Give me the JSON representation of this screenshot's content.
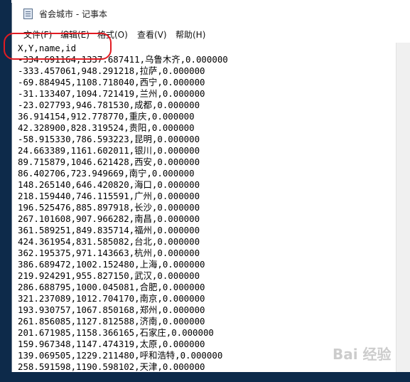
{
  "window": {
    "title": "省会城市 - 记事本"
  },
  "menu": [
    "文件(F)",
    "编辑(E)",
    "格式(O)",
    "查看(V)",
    "帮助(H)"
  ],
  "lines": [
    "X,Y,name,id",
    "-334.691164,1337.687411,乌鲁木齐,0.000000",
    "-333.457061,948.291218,拉萨,0.000000",
    "-69.884945,1108.718040,西宁,0.000000",
    "-31.133407,1094.721419,兰州,0.000000",
    "-23.027793,946.781530,成都,0.000000",
    "36.914154,912.778770,重庆,0.000000",
    "42.328900,828.319524,贵阳,0.000000",
    "-58.915330,786.593223,昆明,0.000000",
    "24.663389,1161.602011,银川,0.000000",
    "89.715879,1046.621428,西安,0.000000",
    "86.402706,723.949669,南宁,0.000000",
    "148.265140,646.420820,海口,0.000000",
    "218.159440,746.115591,广州,0.000000",
    "196.525476,885.897918,长沙,0.000000",
    "267.101608,907.966282,南昌,0.000000",
    "361.589251,849.835714,福州,0.000000",
    "424.361954,831.585082,台北,0.000000",
    "362.195375,971.143663,杭州,0.000000",
    "386.689472,1002.152480,上海,0.000000",
    "219.924291,955.827150,武汉,0.000000",
    "286.688795,1000.045081,合肥,0.000000",
    "321.237089,1012.704170,南京,0.000000",
    "193.930757,1067.850168,郑州,0.000000",
    "261.856085,1127.812588,济南,0.000000",
    "201.671985,1158.366165,石家庄,0.000000",
    "159.967348,1147.474319,太原,0.000000",
    "139.069505,1229.211480,呼和浩特,0.000000",
    "258.591598,1190.598102,天津,0.000000"
  ],
  "watermark": "Bai 经验",
  "colors": {
    "annotation": "#e11b22",
    "desktop": "#0d2a4a"
  }
}
